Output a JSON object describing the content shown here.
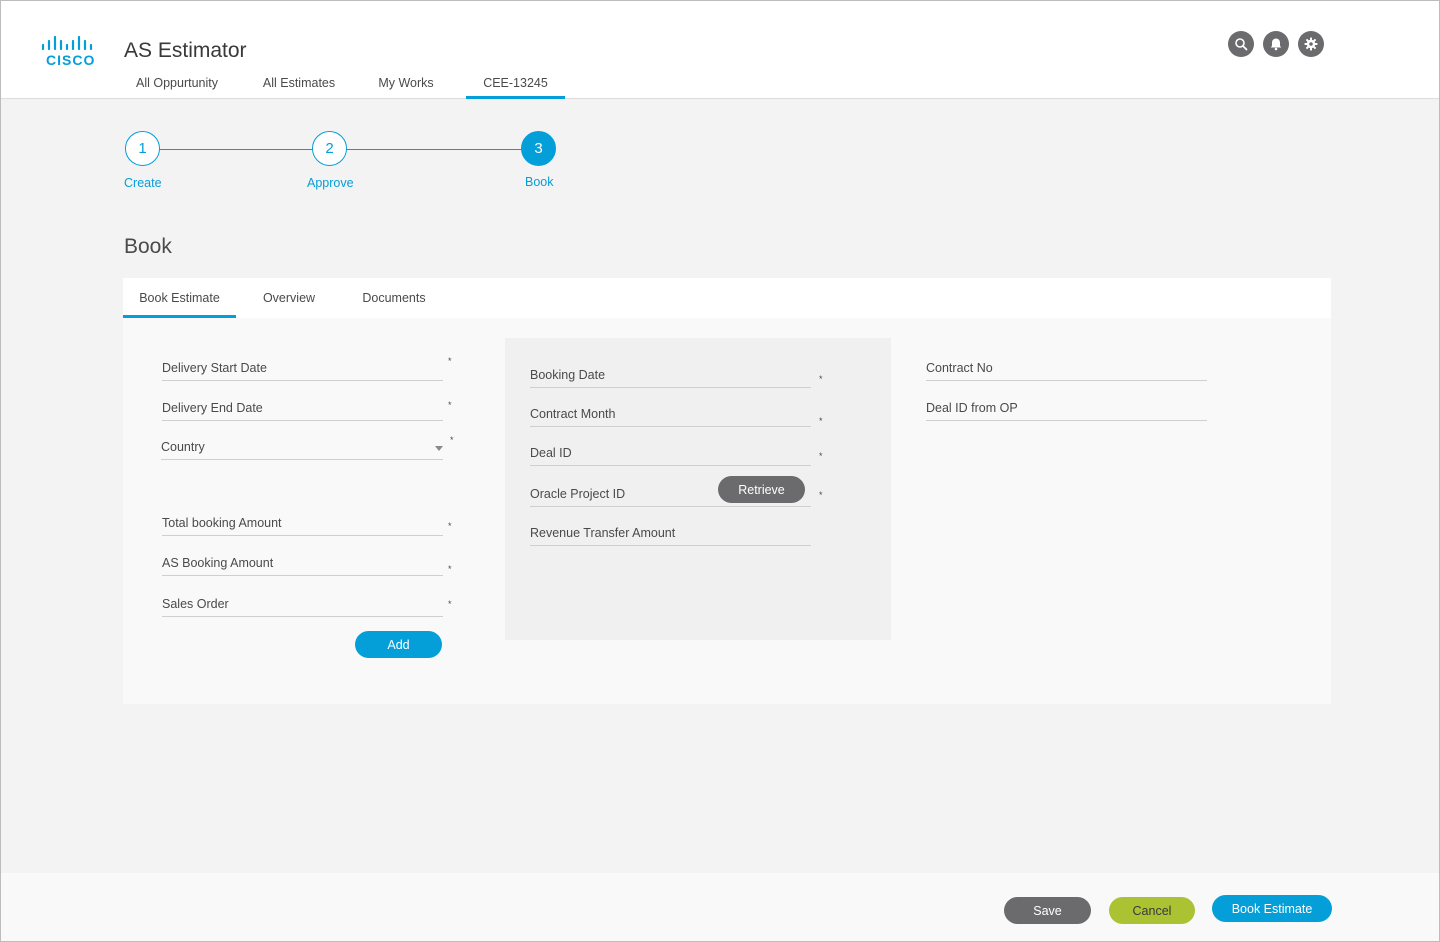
{
  "header": {
    "logo_text": "CISCO",
    "app_title": "AS Estimator",
    "nav": [
      {
        "label": "All Oppurtunity"
      },
      {
        "label": "All Estimates"
      },
      {
        "label": "My Works"
      },
      {
        "label": "CEE-13245",
        "active": true
      }
    ],
    "icons": [
      "search-icon",
      "bell-icon",
      "gear-icon"
    ]
  },
  "stepper": {
    "steps": [
      {
        "number": "1",
        "label": "Create"
      },
      {
        "number": "2",
        "label": "Approve"
      },
      {
        "number": "3",
        "label": "Book",
        "active": true
      }
    ]
  },
  "page": {
    "title": "Book"
  },
  "tabs": [
    {
      "label": "Book Estimate",
      "active": true
    },
    {
      "label": "Overview"
    },
    {
      "label": "Documents"
    }
  ],
  "form": {
    "left": [
      {
        "label": "Delivery Start Date",
        "required": true
      },
      {
        "label": "Delivery End Date",
        "required": true
      },
      {
        "label": "Country",
        "required": true,
        "dropdown": true
      },
      {
        "label": "Total booking Amount",
        "required": true
      },
      {
        "label": "AS Booking Amount",
        "required": true
      },
      {
        "label": "Sales Order",
        "required": true
      }
    ],
    "add_label": "Add",
    "middle": [
      {
        "label": "Booking Date",
        "required": true
      },
      {
        "label": "Contract Month",
        "required": true
      },
      {
        "label": "Deal  ID",
        "required": true
      },
      {
        "label": "Oracle  Project ID",
        "required": true
      },
      {
        "label": "Revenue Transfer Amount",
        "required": false
      }
    ],
    "retrieve_label": "Retrieve",
    "right": [
      {
        "label": "Contract No"
      },
      {
        "label": "Deal ID from OP"
      }
    ],
    "required_mark": "*"
  },
  "footer": {
    "save_label": "Save",
    "cancel_label": "Cancel",
    "book_label": "Book Estimate"
  },
  "colors": {
    "accent": "#049fd9",
    "secondary": "#6b6b6d",
    "cancel": "#abc233"
  }
}
